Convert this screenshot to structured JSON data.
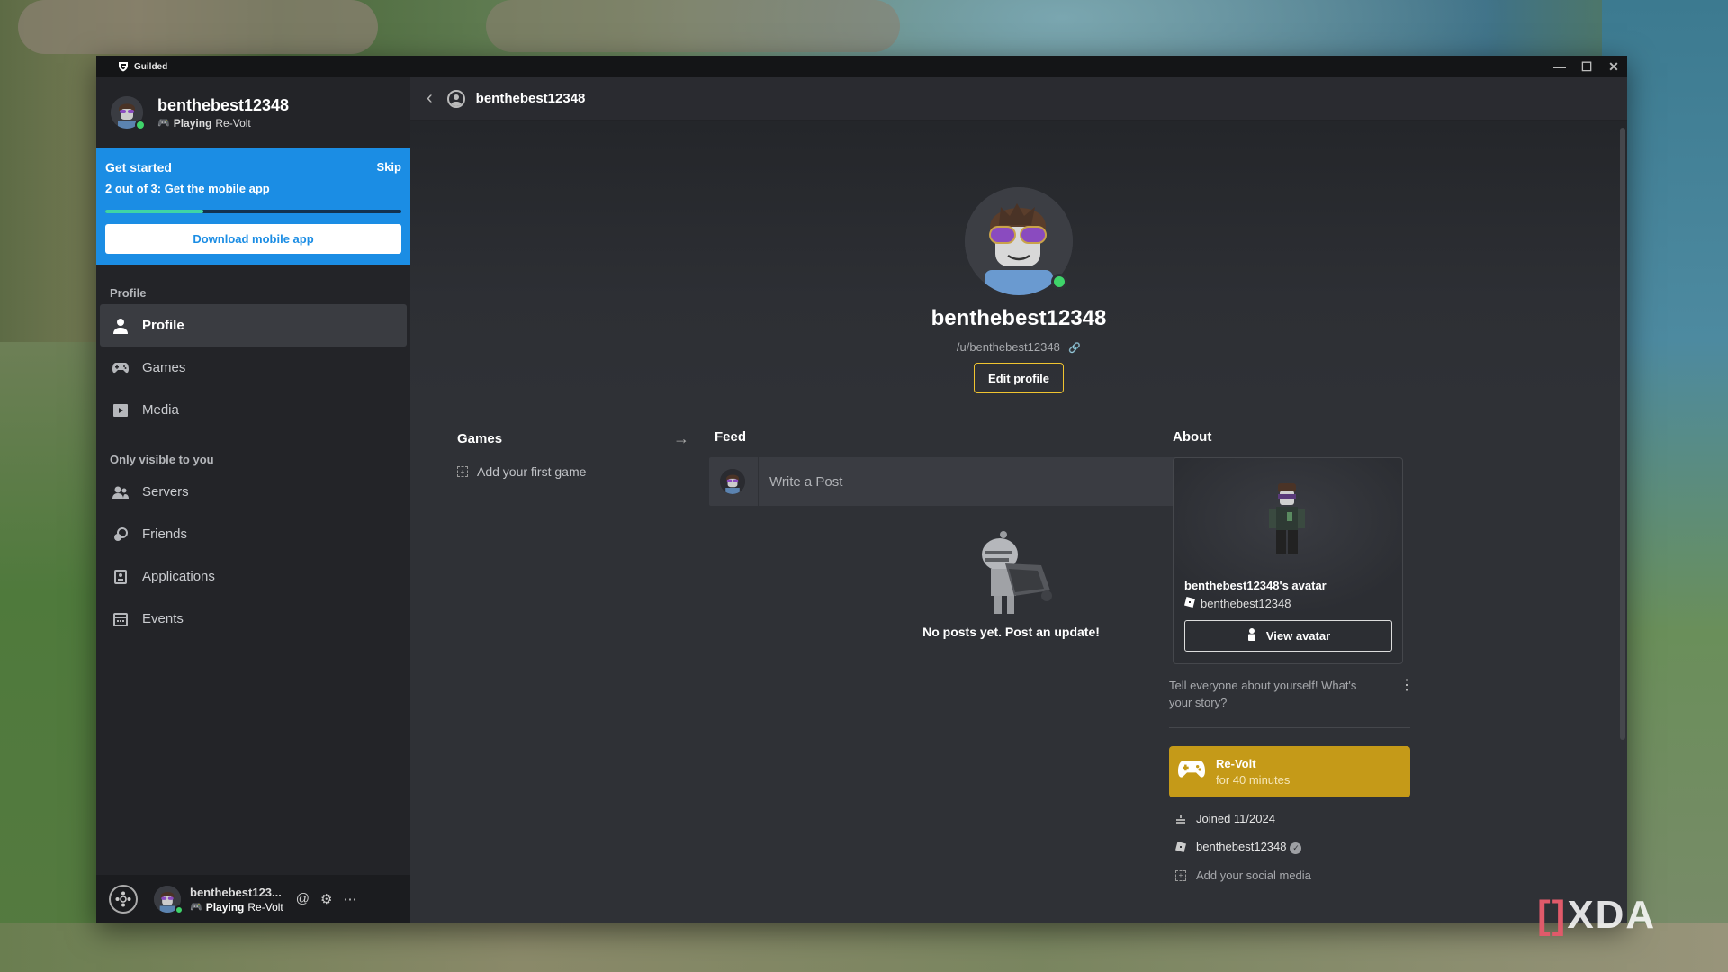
{
  "app": {
    "title": "Guilded"
  },
  "window_controls": {
    "minimize": "—",
    "maximize": "☐",
    "close": "✕"
  },
  "sidebar": {
    "user": {
      "name": "benthebest12348",
      "status_prefix": "Playing",
      "status_game": "Re-Volt"
    },
    "get_started": {
      "title": "Get started",
      "skip": "Skip",
      "step": "2 out of 3: Get the mobile app",
      "progress": 0.33,
      "button": "Download mobile app"
    },
    "section_profile": "Profile",
    "items_profile": [
      {
        "label": "Profile",
        "icon": "person-icon",
        "active": true
      },
      {
        "label": "Games",
        "icon": "gamepad-icon"
      },
      {
        "label": "Media",
        "icon": "media-icon"
      }
    ],
    "section_private": "Only visible to you",
    "items_private": [
      {
        "label": "Servers",
        "icon": "servers-icon"
      },
      {
        "label": "Friends",
        "icon": "friends-icon"
      },
      {
        "label": "Applications",
        "icon": "applications-icon"
      },
      {
        "label": "Events",
        "icon": "calendar-icon"
      }
    ],
    "footer": {
      "name": "benthebest123...",
      "status_prefix": "Playing",
      "status_game": "Re-Volt"
    }
  },
  "topbar": {
    "title": "benthebest12348"
  },
  "profile": {
    "name": "benthebest12348",
    "handle": "/u/benthebest12348",
    "edit_button": "Edit profile"
  },
  "games": {
    "title": "Games",
    "add": "Add your first game"
  },
  "feed": {
    "title": "Feed",
    "write_placeholder": "Write a Post",
    "empty": "No posts yet. Post an update!"
  },
  "about": {
    "title": "About",
    "avatar_card": {
      "title": "benthebest12348's avatar",
      "username": "benthebest12348",
      "button": "View avatar"
    },
    "bio": "Tell everyone about yourself! What's your story?",
    "playing": {
      "game": "Re-Volt",
      "duration": "for 40 minutes"
    },
    "joined": "Joined 11/2024",
    "roblox_user": "benthebest12348",
    "add_social": "Add your social media"
  },
  "watermark": {
    "bracket": "[]",
    "text": "XDA"
  },
  "colors": {
    "accent": "#f0c430",
    "banner": "#1b8de4",
    "online": "#3fd46a",
    "playing_card": "#c59a18"
  }
}
